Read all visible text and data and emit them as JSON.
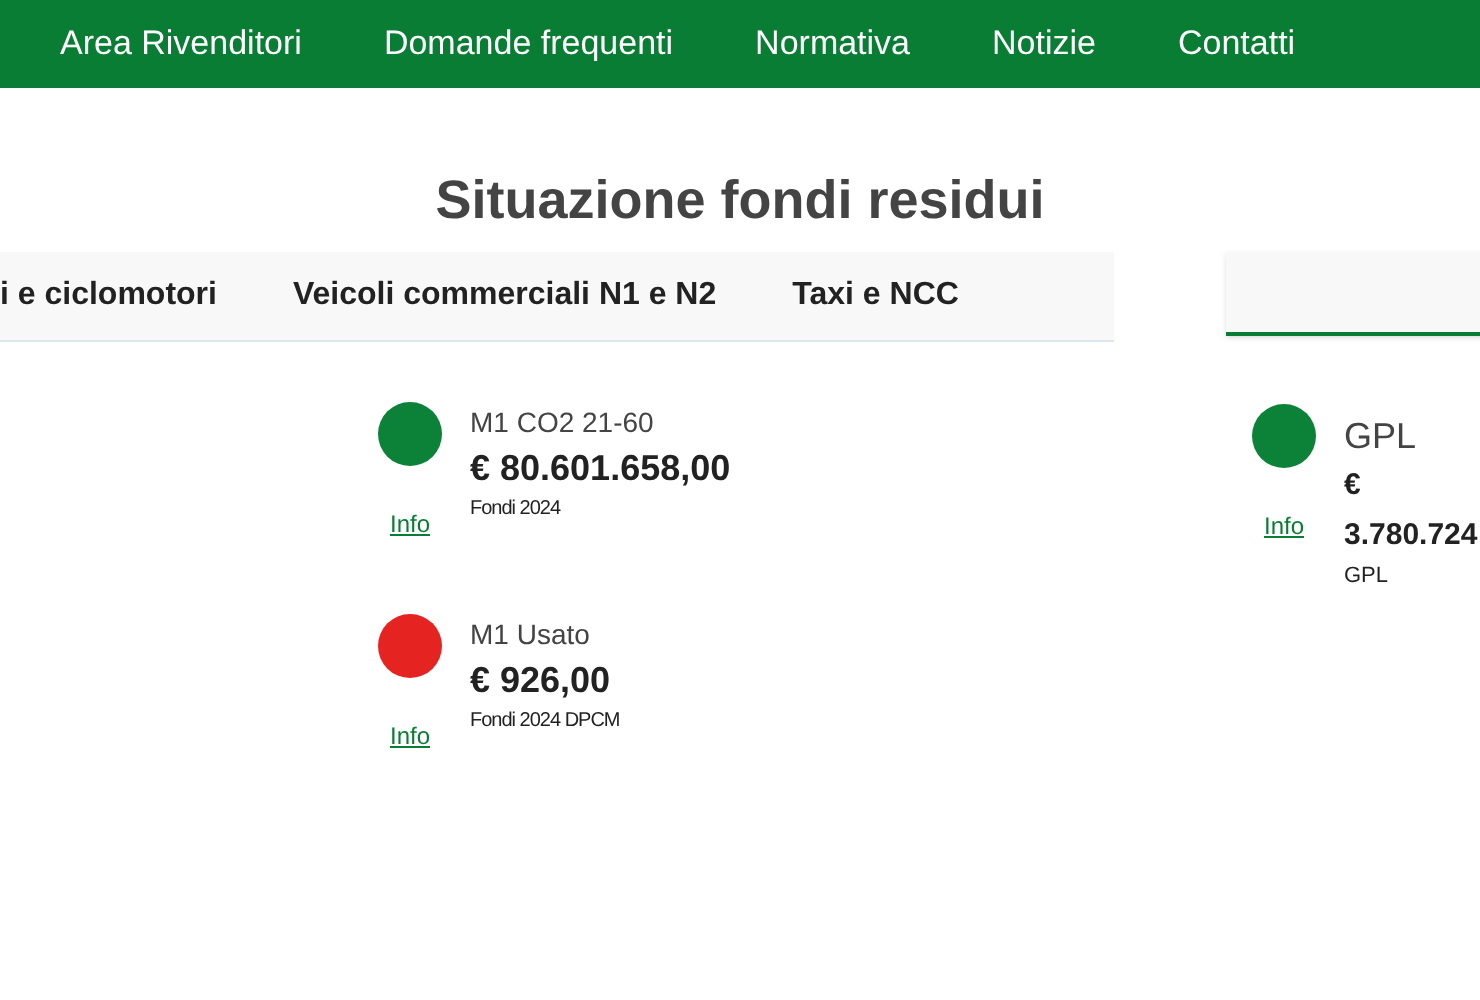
{
  "nav": [
    "Area Rivenditori",
    "Domande frequenti",
    "Normativa",
    "Notizie",
    "Contatti"
  ],
  "title": "Situazione fondi residui",
  "left_panel": {
    "tabs": [
      "i e ciclomotori",
      "Veicoli commerciali N1 e N2",
      "Taxi e NCC"
    ],
    "funds": [
      {
        "name": "M1 CO2 21-60",
        "amount": "€ 80.601.658,00",
        "note": "Fondi 2024",
        "link": "Info",
        "color": "#0b8237"
      },
      {
        "name": "M1 Usato",
        "amount": "€ 926,00",
        "note": "Fondi 2024 DPCM",
        "link": "Info",
        "color": "#e52421"
      }
    ]
  },
  "right_panel": {
    "funds": [
      {
        "name": "GPL",
        "amount_lines": [
          "€",
          "3.780.724"
        ],
        "note": "GPL",
        "link": "Info",
        "color": "#0b8237"
      }
    ]
  }
}
